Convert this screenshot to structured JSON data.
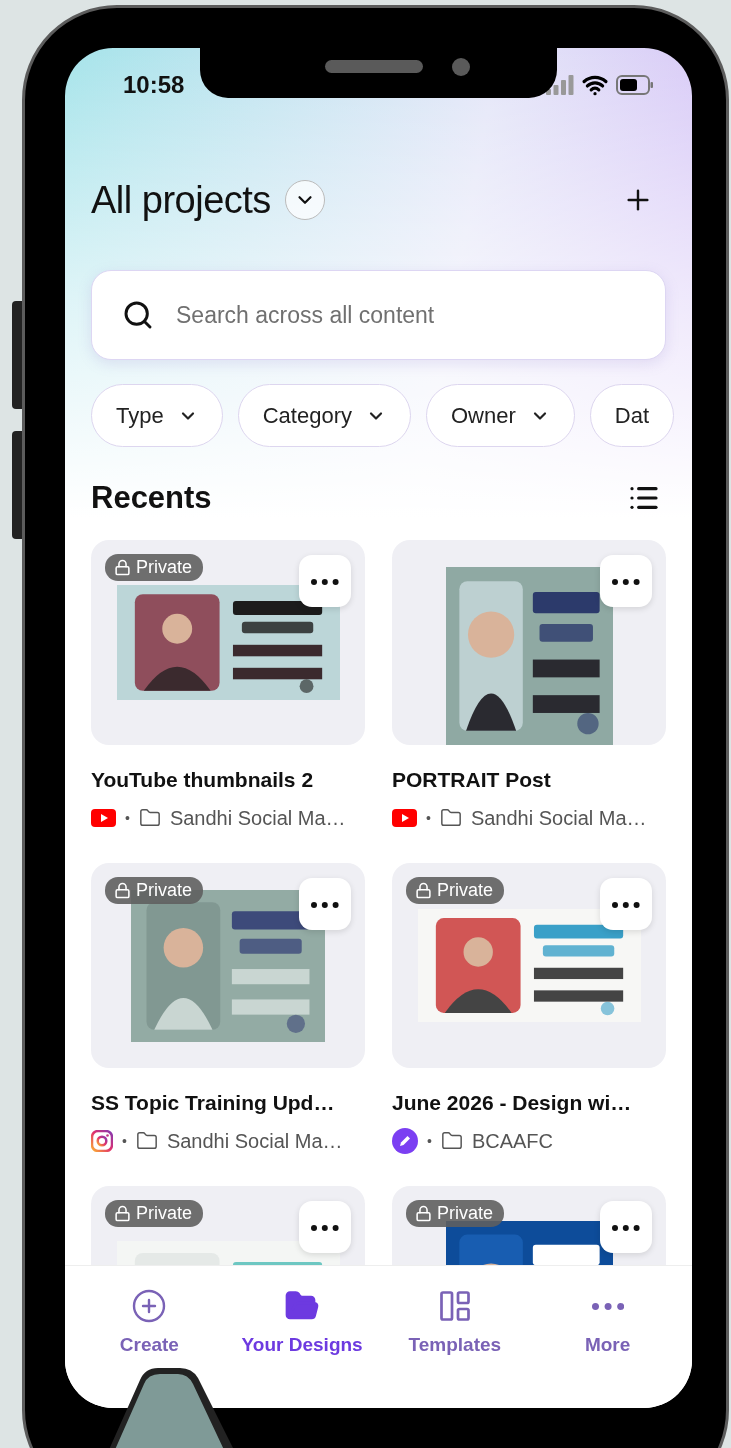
{
  "status_bar": {
    "time": "10:58"
  },
  "header": {
    "title": "All projects"
  },
  "search": {
    "placeholder": "Search across all content"
  },
  "filters": [
    {
      "label": "Type"
    },
    {
      "label": "Category"
    },
    {
      "label": "Owner"
    },
    {
      "label": "Dat"
    }
  ],
  "recents": {
    "title": "Recents",
    "designs": [
      {
        "title": "YouTube thumbnails 2",
        "source": {
          "kind": "youtube"
        },
        "separator": "•",
        "folder": "Sandhi Social Ma…",
        "badge": "Private"
      },
      {
        "title": "PORTRAIT Post",
        "source": {
          "kind": "youtube"
        },
        "separator": "•",
        "folder": "Sandhi Social Ma…"
      },
      {
        "title": "SS Topic Training Upd…",
        "source": {
          "kind": "instagram"
        },
        "separator": "•",
        "folder": "Sandhi Social Ma…",
        "badge": "Private"
      },
      {
        "title": "June 2026 - Design wi…",
        "source": {
          "kind": "canva"
        },
        "separator": "•",
        "folder": "BCAAFC",
        "badge": "Private"
      },
      {
        "badge": "Private"
      },
      {
        "badge": "Private"
      }
    ]
  },
  "tab_bar": {
    "tabs": [
      {
        "label": "Create",
        "kind": "create",
        "selected": false
      },
      {
        "label": "Your Designs",
        "kind": "designs",
        "selected": true
      },
      {
        "label": "Templates",
        "kind": "templates",
        "selected": false
      },
      {
        "label": "More",
        "kind": "more",
        "selected": false
      }
    ]
  }
}
